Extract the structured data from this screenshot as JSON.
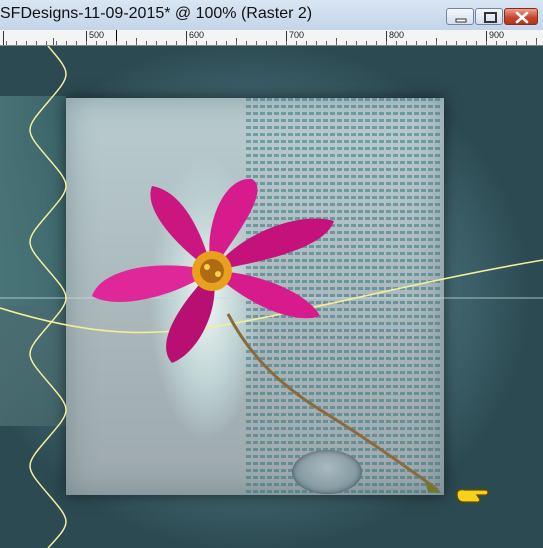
{
  "window": {
    "title": "SFDesigns-11-09-2015* @ 100% (Raster 2)",
    "controls": {
      "minimize_icon": "minimize-icon",
      "maximize_icon": "maximize-icon",
      "close_icon": "close-icon"
    }
  },
  "ruler": {
    "labels": [
      "500",
      "600",
      "700",
      "800",
      "900"
    ]
  },
  "canvas": {
    "layer_name": "Raster 2",
    "zoom": "100%",
    "pointer_icon": "pointing-hand-icon",
    "colors": {
      "flower": "#d81b8c",
      "flower_center": "#e8a11c",
      "guide_line": "#f4ef9a"
    }
  }
}
